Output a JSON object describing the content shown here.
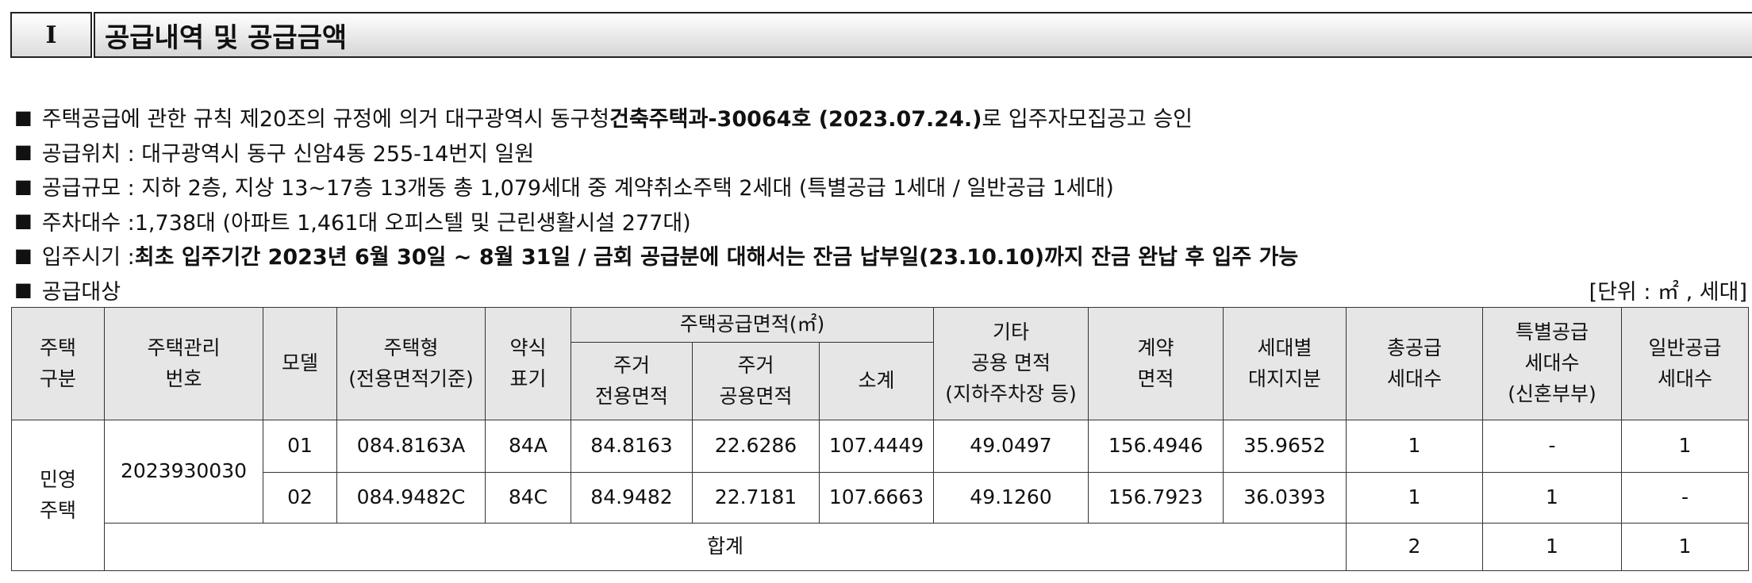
{
  "section": {
    "number": "I",
    "title": "공급내역 및 공급금액"
  },
  "bullet": "■",
  "notices": {
    "approval": {
      "pre": "주택공급에 관한 규칙 제20조의 규정에 의거 대구광역시 동구청 ",
      "bold": "건축주택과-30064호 (2023.07.24.)",
      "post": "로 입주자모집공고 승인"
    },
    "location": "공급위치 : 대구광역시 동구 신암4동 255-14번지 일원",
    "scale": "공급규모 : 지하 2층, 지상 13~17층 13개동 총 1,079세대 중 계약취소주택 2세대 (특별공급 1세대 / 일반공급 1세대)",
    "parking": "주차대수 :1,738대 (아파트 1,461대 오피스텔 및 근린생활시설 277대)",
    "movein": {
      "pre": "입주시기 : ",
      "bold": "최초 입주기간  2023년 6월 30일 ~ 8월 31일 / 금회 공급분에 대해서는 잔금 납부일(23.10.10)까지 잔금 완납 후 입주 가능"
    },
    "target": "공급대상",
    "unit": "[단위 : ㎡ , 세대]"
  },
  "table": {
    "headers": {
      "housing_type_1": "주택",
      "housing_type_2": "구분",
      "mgmt_no_1": "주택관리",
      "mgmt_no_2": "번호",
      "model": "모델",
      "type_1": "주택형",
      "type_2": "(전용면적기준)",
      "abbr_1": "약식",
      "abbr_2": "표기",
      "supply_area": "주택공급면적(㎡)",
      "excl_1": "주거",
      "excl_2": "전용면적",
      "common_1": "주거",
      "common_2": "공용면적",
      "subtotal": "소계",
      "other_1": "기타",
      "other_2": "공용 면적",
      "other_3": "(지하주차장 등)",
      "contract_1": "계약",
      "contract_2": "면적",
      "land_1": "세대별",
      "land_2": "대지지분",
      "total_1": "총공급",
      "total_2": "세대수",
      "special_1": "특별공급",
      "special_2": "세대수",
      "special_3": "(신혼부부)",
      "general_1": "일반공급",
      "general_2": "세대수"
    },
    "category_1": "민영",
    "category_2": "주택",
    "mgmt_no": "2023930030",
    "rows": [
      {
        "model": "01",
        "type": "084.8163A",
        "abbr": "84A",
        "excl": "84.8163",
        "common": "22.6286",
        "subtotal": "107.4449",
        "other": "49.0497",
        "contract": "156.4946",
        "land": "35.9652",
        "total": "1",
        "special": "-",
        "general": "1"
      },
      {
        "model": "02",
        "type": "084.9482C",
        "abbr": "84C",
        "excl": "84.9482",
        "common": "22.7181",
        "subtotal": "107.6663",
        "other": "49.1260",
        "contract": "156.7923",
        "land": "36.0393",
        "total": "1",
        "special": "1",
        "general": "-"
      }
    ],
    "sum": {
      "label": "합계",
      "total": "2",
      "special": "1",
      "general": "1"
    }
  }
}
